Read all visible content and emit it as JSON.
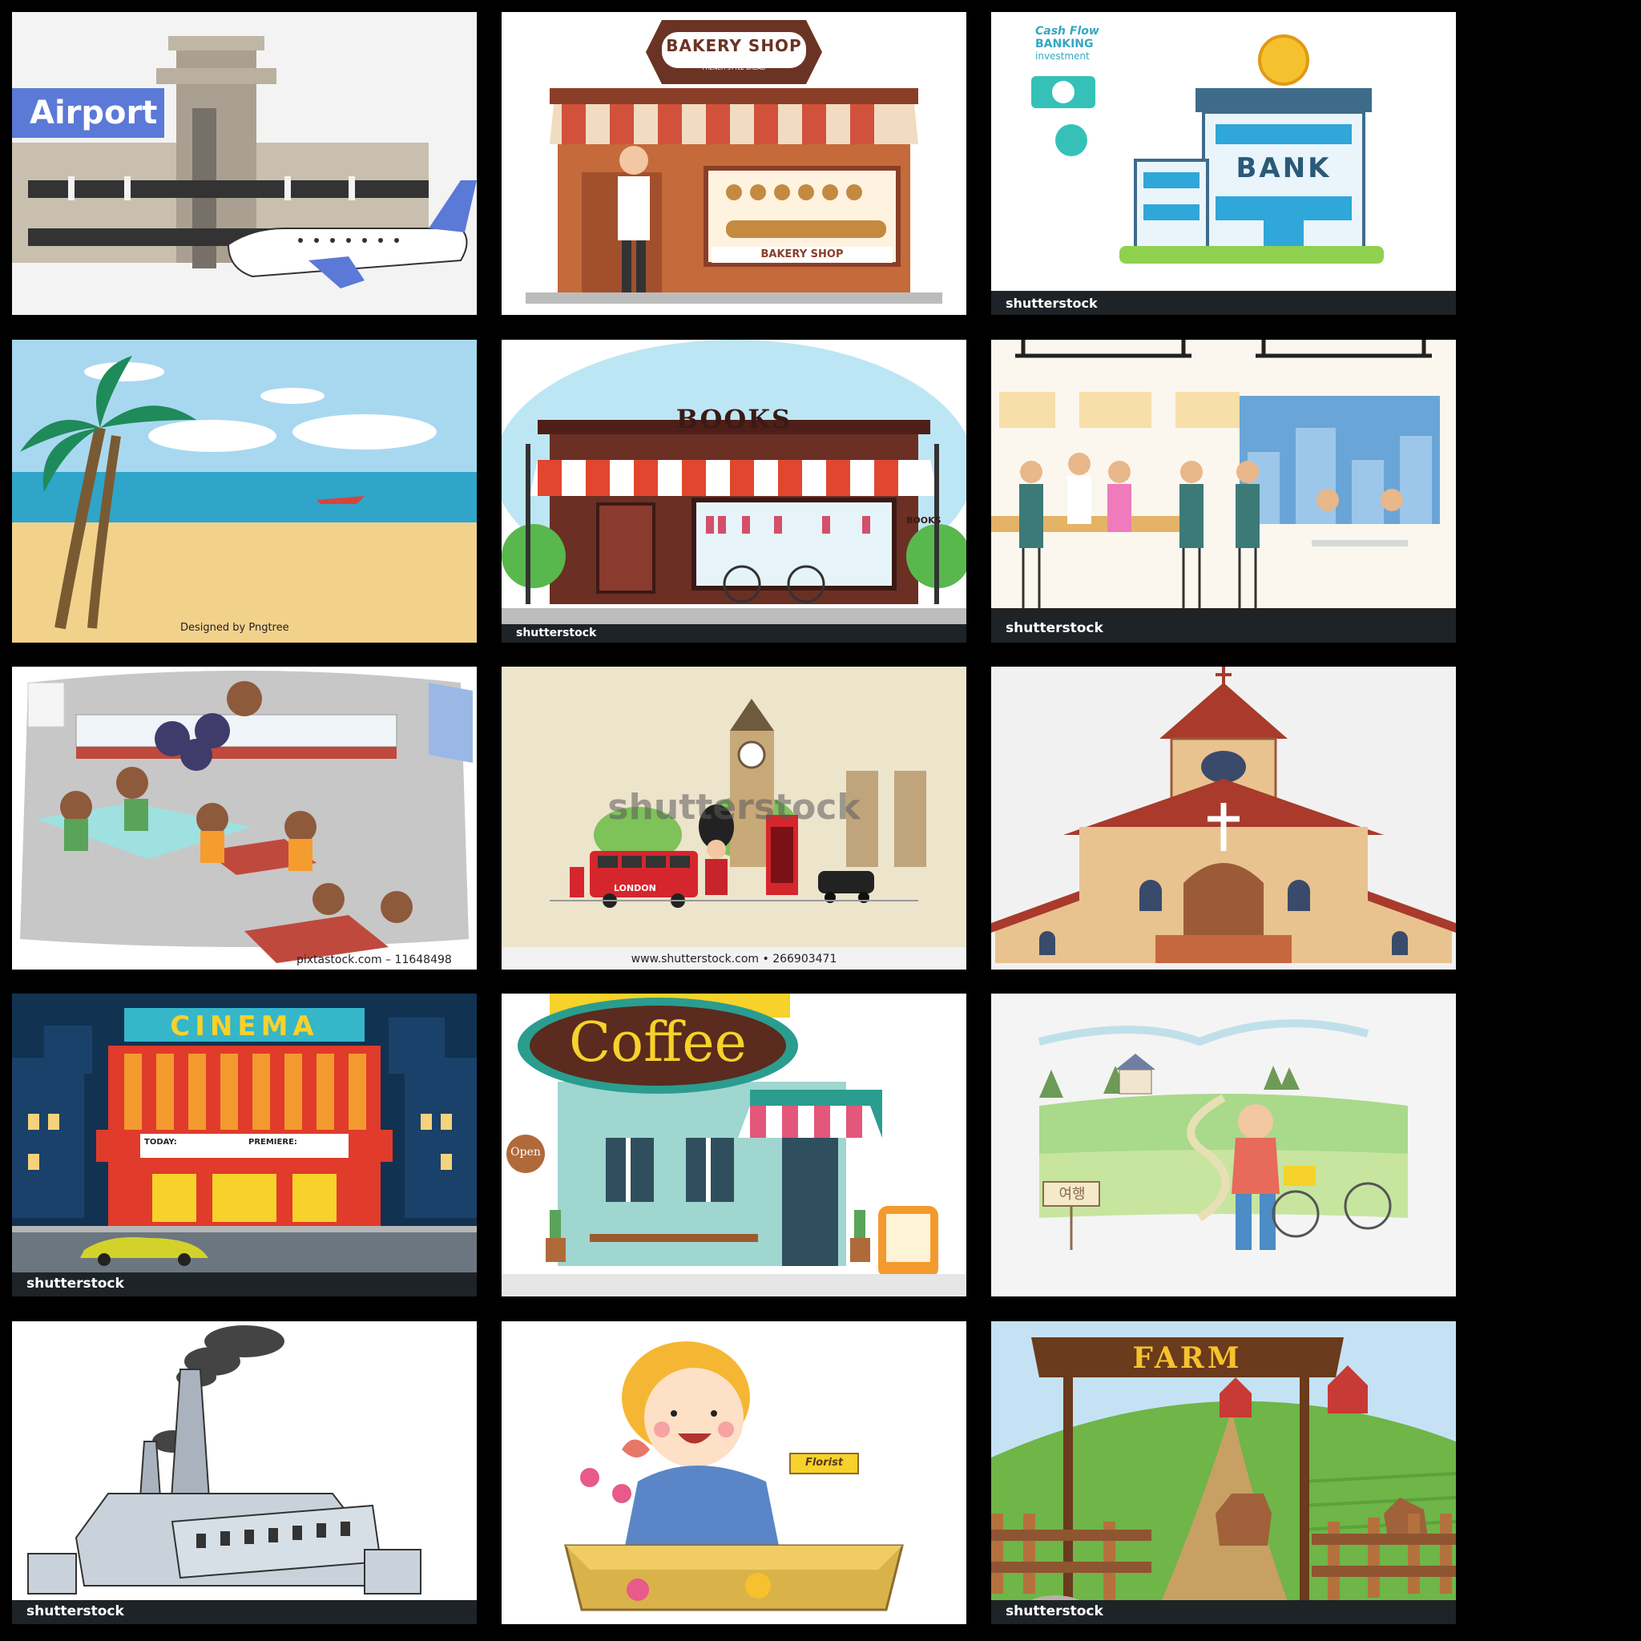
{
  "tiles": {
    "airport": {
      "label": "Airport"
    },
    "bakery": {
      "sign": "BAKERY SHOP",
      "subsign": "FRENCH STYLE BREAD",
      "window_sign": "BAKERY SHOP"
    },
    "bank": {
      "promo_1": "Cash Flow",
      "promo_2": "BANKING",
      "promo_3": "investment",
      "sign": "BANK",
      "watermark": "shutterstock"
    },
    "beach": {
      "credit": "Designed by Pngtree"
    },
    "bookstore": {
      "sign": "BOOKS",
      "side_sign": "BOOKS",
      "watermark": "shutterstock"
    },
    "cafeteria": {
      "watermark": "shutterstock"
    },
    "school_canteen": {
      "credit": "pixtastock.com – 11648498"
    },
    "london": {
      "overlay": "shutterstock",
      "bus_text": "LONDON",
      "credit": "www.shutterstock.com • 266903471"
    },
    "church": {},
    "cinema": {
      "sign": "CINEMA",
      "today": "TODAY:",
      "premiere": "PREMIERE:",
      "watermark": "shutterstock"
    },
    "coffee": {
      "sign": "Coffee",
      "open_sign": "Open"
    },
    "countryside": {
      "sign": "여행"
    },
    "factory": {
      "watermark": "shutterstock"
    },
    "florist": {
      "ribbon": "Florist"
    },
    "farm": {
      "sign": "FARM",
      "watermark": "shutterstock"
    }
  },
  "colors": {
    "background": "#000000",
    "airport_accent": "#5b79d6",
    "bakery_awning": "#d1513c",
    "bank_blue": "#2fa7d8",
    "beach_sky": "#a8d8f0",
    "cinema_sign": "#36b6c9",
    "coffee_oval": "#5a2b1e",
    "farm_sign": "#6a3b1c"
  }
}
